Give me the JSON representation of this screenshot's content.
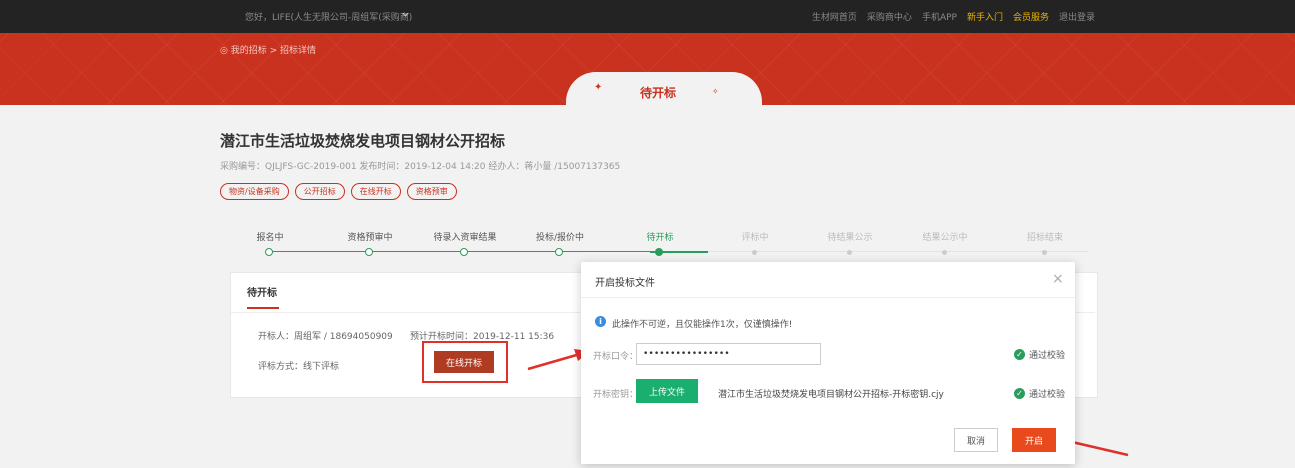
{
  "topbar": {
    "greeting": "您好，LIFE(人生无限公司-周组军(采购商)",
    "links": [
      "生材网首页",
      "采购商中心",
      "手机APP",
      "新手入门",
      "会员服务",
      "退出登录"
    ]
  },
  "breadcrumb": "◎ 我的招标 > 招标详情",
  "status_tab": "待开标",
  "project": {
    "title": "潜江市生活垃圾焚烧发电项目钢材公开招标",
    "meta": "采购编号：QJLJFS-GC-2019-001   发布时间：2019-12-04 14:20   经办人：蒋小量 /15007137365",
    "tags": [
      "物资/设备采购",
      "公开招标",
      "在线开标",
      "资格预审"
    ]
  },
  "steps": {
    "items": [
      "报名中",
      "资格预审中",
      "待录入资审结果",
      "投标/报价中",
      "待开标",
      "评标中",
      "待结果公示",
      "结果公示中",
      "招标结束"
    ],
    "current_index": 4
  },
  "card": {
    "title": "待开标",
    "opener": "开标人：周组军 / 18694050909",
    "planned_time": "预计开标时间：2019-12-11 15:36",
    "eval_method": "评标方式：线下评标",
    "online_open_label": "在线开标"
  },
  "modal": {
    "title": "开启投标文件",
    "close": "×",
    "warning": "此操作不可逆，且仅能操作1次，仅谨慎操作!",
    "password_label": "开标口令：",
    "password_value": "••••••••••••••••",
    "key_label": "开标密钥：",
    "upload_label": "上传文件",
    "key_file": "潜江市生活垃圾焚烧发电项目钢材公开招标-开标密钥.cjy",
    "verified_label": "通过校验",
    "cancel_label": "取消",
    "open_label": "开启"
  },
  "colors": {
    "brand_red": "#c8321e",
    "success_green": "#2a9d5c",
    "upload_green": "#1aae6f",
    "annotation_red": "#e0302a"
  }
}
